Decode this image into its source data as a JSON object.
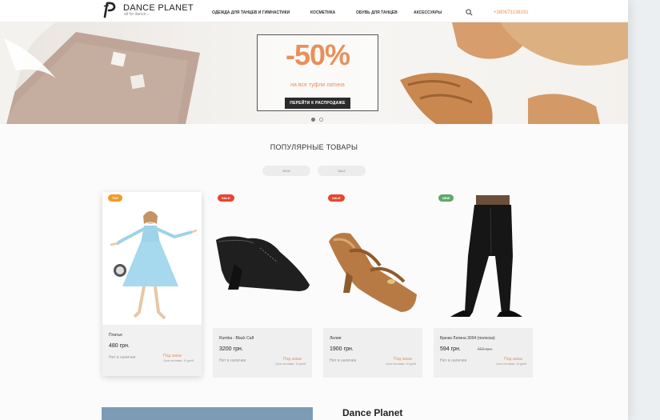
{
  "header": {
    "brand": "DANCE PLANET",
    "tagline": "all for dance...",
    "nav": [
      {
        "label": "ОДЕЖДА ДЛЯ ТАНЦЕВ И ГИМНАСТИКИ"
      },
      {
        "label": "КОСМЕТИКА"
      },
      {
        "label": "ОБУВЬ ДЛЯ ТАНЦЕВ"
      },
      {
        "label": "АКСЕССУАРЫ"
      }
    ],
    "search_icon": "search-icon",
    "phone": "+380673138191"
  },
  "hero": {
    "discount": "-50%",
    "subtitle": "на все туфли латина",
    "cta": "ПЕРЕЙТИ К РАСПРОДАЖЕ",
    "slides_total": 2,
    "active_slide": 1
  },
  "popular": {
    "title": "ПОПУЛЯРНЫЕ ТОВАРЫ",
    "filters": [
      "NEW",
      "SALE"
    ],
    "products": [
      {
        "badge": "TOP",
        "name": "Платье",
        "price": "480 грн.",
        "old_price": "",
        "stock": "Нет в наличии",
        "order": "Под заказ",
        "term": "Срок поставки: 10 дней"
      },
      {
        "badge": "SALE",
        "name": "Rumba - Black Calf",
        "price": "3200 грн.",
        "old_price": "",
        "stock": "Нет в наличии",
        "order": "Под заказ",
        "term": "Срок поставки: 10 дней"
      },
      {
        "badge": "SALE",
        "name": "Лилия",
        "price": "1900 грн.",
        "old_price": "",
        "stock": "Нет в наличии",
        "order": "Под заказ",
        "term": "Срок поставки: 10 дней"
      },
      {
        "badge": "NEW",
        "name": "Брюки Латина 3004 (полоска)",
        "price": "594 грн.",
        "old_price": "660 грн.",
        "stock": "Нет в наличии",
        "order": "Под заказ",
        "term": "Срок поставки: 10 дней"
      }
    ]
  },
  "about": {
    "title": "Dance Planet"
  },
  "colors": {
    "accent": "#e8905a",
    "badge_top": "#f39a2b",
    "badge_sale": "#e5452f",
    "badge_new": "#5fa86a",
    "dark": "#2b2b2b"
  }
}
